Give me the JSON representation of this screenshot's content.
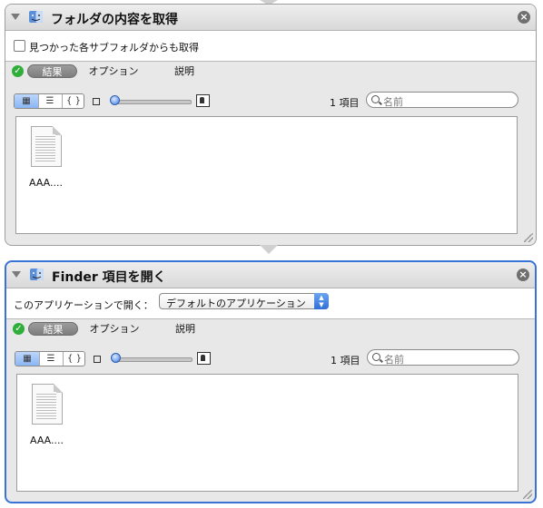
{
  "actions": [
    {
      "title": "フォルダの内容を取得",
      "option_label": "見つかった各サブフォルダからも取得",
      "tabs": [
        "結果",
        "オプション",
        "説明"
      ],
      "item_count": "1 項目",
      "search_placeholder": "名前",
      "file_name": "AAA...."
    },
    {
      "title": "Finder 項目を開く",
      "open_with_label": "このアプリケーションで開く：",
      "open_with_value": "デフォルトのアプリケーション",
      "tabs": [
        "結果",
        "オプション",
        "説明"
      ],
      "item_count": "1 項目",
      "search_placeholder": "名前",
      "file_name": "AAA...."
    }
  ],
  "icons": {
    "close": "close-icon",
    "ok": "checkmark-icon",
    "disclosure": "disclosure-triangle-icon",
    "view_icon": "icon-view-icon",
    "view_list": "list-view-icon",
    "view_code": "code-view-icon",
    "search": "search-icon"
  },
  "colors": {
    "selected_border": "#3a73d6",
    "ok_green": "#2fae3a"
  }
}
